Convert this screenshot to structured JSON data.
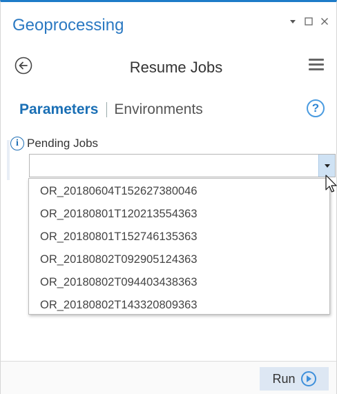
{
  "pane": {
    "title": "Geoprocessing",
    "pin_icon": "pin-dropdown-icon",
    "maximize_icon": "maximize-icon",
    "close_icon": "close-icon"
  },
  "tool": {
    "title": "Resume Jobs",
    "back_icon": "back-arrow-icon",
    "menu_icon": "hamburger-menu-icon"
  },
  "tabs": {
    "parameters": "Parameters",
    "environments": "Environments",
    "help_label": "?"
  },
  "parameter": {
    "label": "Pending Jobs",
    "info_glyph": "i",
    "value": "",
    "options": [
      "OR_20180604T152627380046",
      "OR_20180801T120213554363",
      "OR_20180801T152746135363",
      "OR_20180802T092905124363",
      "OR_20180802T094403438363",
      "OR_20180802T143320809363"
    ]
  },
  "footer": {
    "run_label": "Run",
    "run_icon": "play-circle-icon"
  },
  "colors": {
    "accent": "#1e7bc8",
    "title_blue": "#2b79c2",
    "tab_active": "#1a6fb5"
  }
}
